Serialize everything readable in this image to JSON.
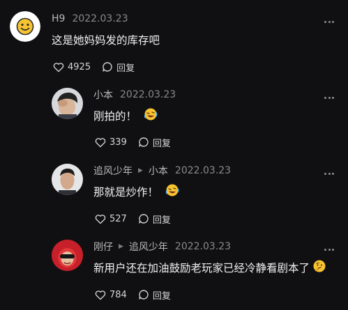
{
  "comments": [
    {
      "author": "H9",
      "date": "2022.03.23",
      "text": "这是她妈妈发的库存吧",
      "likes": "4925",
      "reply_label": "回复",
      "avatar_icon": "smiley-face-avatar"
    },
    {
      "author": "小本",
      "date": "2022.03.23",
      "text": "刚拍的！",
      "emoji_icon": "rolling-laugh-emoji",
      "likes": "339",
      "reply_label": "回复"
    },
    {
      "author": "追风少年",
      "reply_to": "小本",
      "date": "2022.03.23",
      "text": "那就是炒作！",
      "emoji_icon": "rolling-laugh-emoji",
      "likes": "527",
      "reply_label": "回复"
    },
    {
      "author": "刚仔",
      "reply_to": "追风少年",
      "date": "2022.03.23",
      "text": "新用户还在加油鼓励老玩家已经冷静看剧本了",
      "emoji_icon": "thinking-emoji",
      "likes": "784",
      "reply_label": "回复"
    }
  ],
  "icons": {
    "like": "heart-outline-icon",
    "reply": "speech-bubble-icon",
    "more": "more-dots-icon",
    "reply_arrow": "reply-arrow-icon"
  },
  "colors": {
    "background": "#101012",
    "primary_text": "#f1f1f2",
    "secondary_text": "#a6a6aa",
    "emoji_yellow": "#f7c431"
  }
}
